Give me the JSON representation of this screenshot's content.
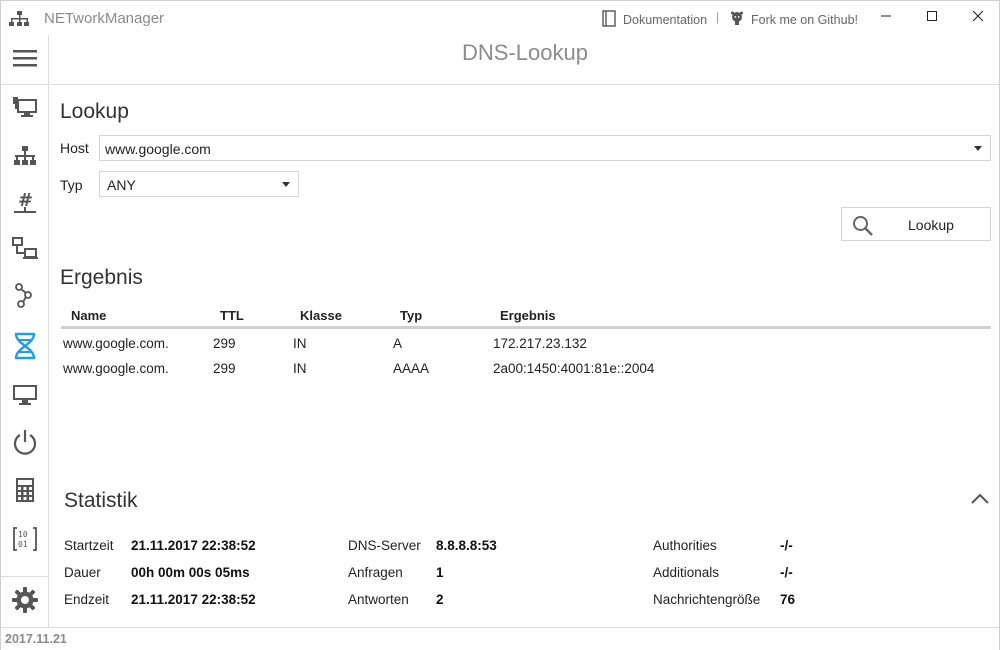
{
  "app": {
    "title": "NETworkManager",
    "doc_link": "Dokumentation",
    "separator": "|",
    "github_link": "Fork me on Github!"
  },
  "sidebar": {
    "items": [
      {
        "icon": "menu-icon"
      },
      {
        "icon": "network-interface-icon"
      },
      {
        "icon": "ip-scanner-icon"
      },
      {
        "icon": "subnet-calculator-icon"
      },
      {
        "icon": "remote-desktop-icon"
      },
      {
        "icon": "traceroute-icon"
      },
      {
        "icon": "dns-lookup-icon",
        "active": true
      },
      {
        "icon": "monitor-icon"
      },
      {
        "icon": "wake-on-lan-icon"
      },
      {
        "icon": "calculator-icon"
      },
      {
        "icon": "binary-icon"
      },
      {
        "icon": "settings-icon"
      }
    ],
    "accent": "#1ba1e2"
  },
  "header": {
    "title": "DNS-Lookup"
  },
  "lookup": {
    "section_title": "Lookup",
    "host_label": "Host",
    "host_value": "www.google.com",
    "type_label": "Typ",
    "type_value": "ANY",
    "button_label": "Lookup"
  },
  "result": {
    "section_title": "Ergebnis",
    "columns": [
      "Name",
      "TTL",
      "Klasse",
      "Typ",
      "Ergebnis"
    ],
    "rows": [
      [
        "www.google.com.",
        "299",
        "IN",
        "A",
        "172.217.23.132"
      ],
      [
        "www.google.com.",
        "299",
        "IN",
        "AAAA",
        "2a00:1450:4001:81e::2004"
      ]
    ]
  },
  "statistics": {
    "section_title": "Statistik",
    "items": [
      {
        "label": "Startzeit",
        "value": "21.11.2017 22:38:52"
      },
      {
        "label": "Dauer",
        "value": "00h 00m 00s 05ms"
      },
      {
        "label": "Endzeit",
        "value": "21.11.2017 22:38:52"
      },
      {
        "label": "DNS-Server",
        "value": "8.8.8.8:53"
      },
      {
        "label": "Anfragen",
        "value": "1"
      },
      {
        "label": "Antworten",
        "value": "2"
      },
      {
        "label": "Authorities",
        "value": "-/-"
      },
      {
        "label": "Additionals",
        "value": "-/-"
      },
      {
        "label": "Nachrichtengröße",
        "value": "76"
      }
    ]
  },
  "status": {
    "version": "2017.11.21"
  }
}
